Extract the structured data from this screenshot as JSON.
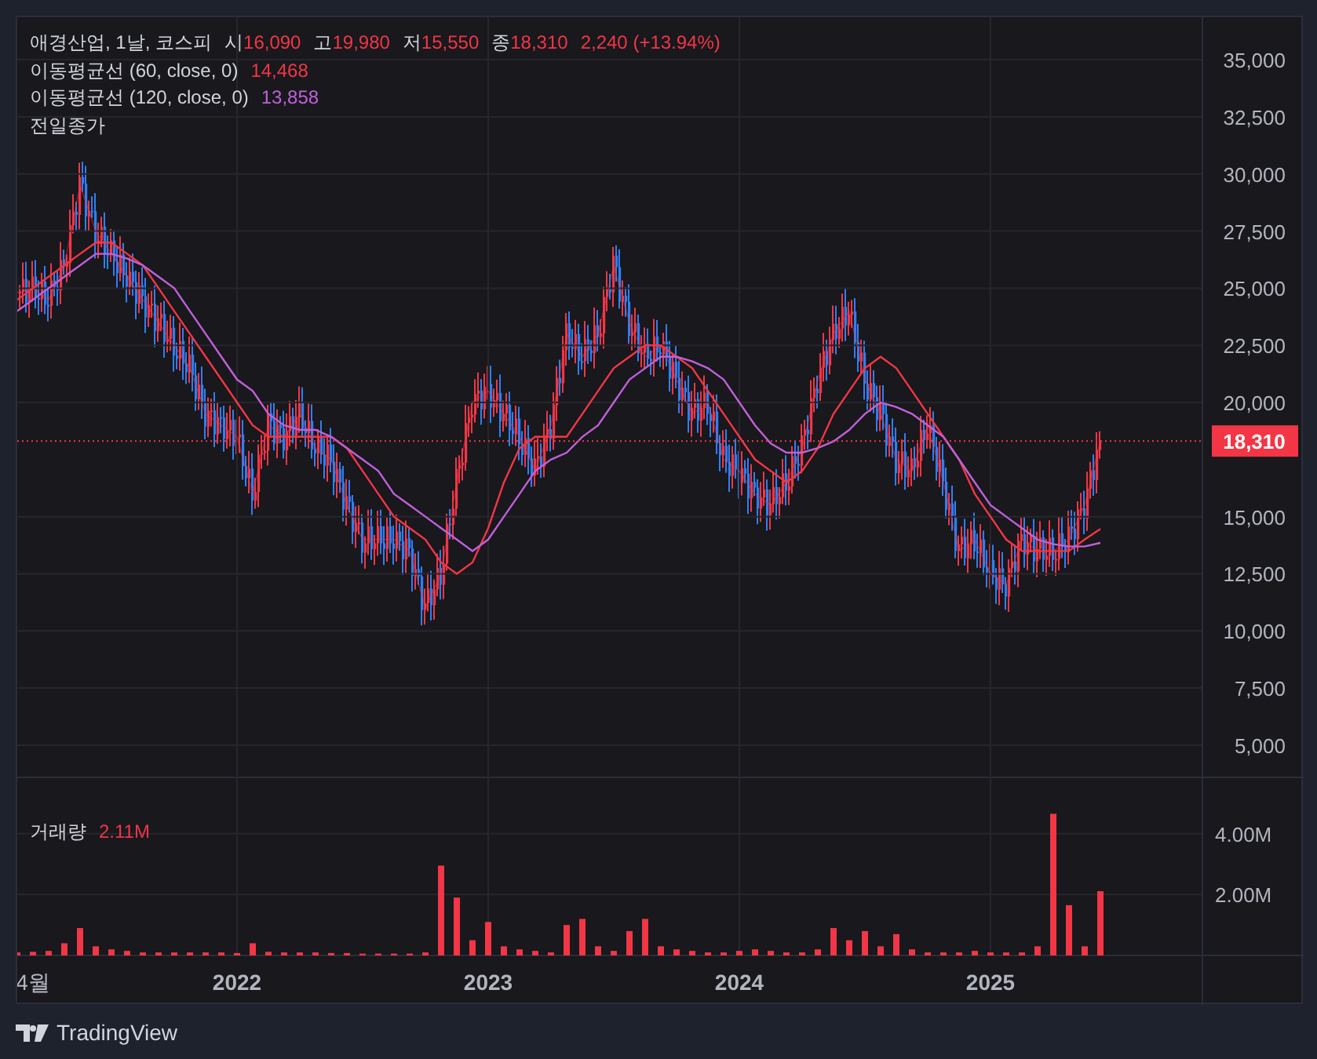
{
  "legend": {
    "title_suffix": ", 1날, 코스피",
    "ohlc": [
      {
        "label": "시",
        "value": "16,090"
      },
      {
        "label": "고",
        "value": "19,980"
      },
      {
        "label": "저",
        "value": "15,550"
      },
      {
        "label": "종",
        "value": "18,310"
      }
    ],
    "change": "2,240 (+13.94%)",
    "indicator_values": [
      "14,468",
      "13,858"
    ],
    "prev_close_label": "전일종가"
  },
  "price_chart": {
    "chart_data": {
      "type": "line",
      "grid": true,
      "ylim": [
        3624,
        36858
      ],
      "ref_lines": [
        {
          "axis": "y",
          "value": 18310,
          "label": "18,310",
          "color": "#f23645"
        }
      ],
      "yticks": [
        {
          "value": 35000,
          "label": "35,000"
        },
        {
          "value": 32500,
          "label": "32,500"
        },
        {
          "value": 30000,
          "label": "30,000"
        },
        {
          "value": 27500,
          "label": "27,500"
        },
        {
          "value": 25000,
          "label": "25,000"
        },
        {
          "value": 22500,
          "label": "22,500"
        },
        {
          "value": 20000,
          "label": "20,000"
        },
        {
          "value": 15000,
          "label": "15,000"
        },
        {
          "value": 12500,
          "label": "12,500"
        },
        {
          "value": 10000,
          "label": "10,000"
        },
        {
          "value": 7500,
          "label": "7,500"
        },
        {
          "value": 5000,
          "label": "5,000"
        }
      ],
      "series": [
        {
          "name": "애경산업",
          "color": "#f23645",
          "values": [
            24800,
            25000,
            24500,
            26000,
            29500,
            27500,
            26500,
            25500,
            24500,
            23500,
            22500,
            21500,
            19500,
            19000,
            18500,
            16000,
            19000,
            18500,
            19500,
            18000,
            17500,
            15500,
            14000,
            14000,
            14000,
            13500,
            11000,
            12500,
            16500,
            20000,
            20500,
            19500,
            18500,
            17000,
            19000,
            23000,
            22000,
            23000,
            26000,
            23500,
            22000,
            22500,
            21000,
            19500,
            20000,
            17500,
            17000,
            16000,
            15500,
            16500,
            18000,
            21000,
            23000,
            24000,
            21000,
            19500,
            17500,
            17000,
            19000,
            16500,
            13500,
            14000,
            12500,
            12000,
            14000,
            13500,
            13500,
            14000,
            15500,
            18310
          ]
        },
        {
          "name": "이동평균선 (60, close, 0)",
          "color": "#f23645",
          "values": [
            24500,
            25000,
            25500,
            26000,
            26500,
            27000,
            27000,
            26500,
            26000,
            25000,
            24000,
            23000,
            22000,
            21000,
            20000,
            19000,
            18500,
            18500,
            18500,
            18500,
            18500,
            18000,
            17000,
            16000,
            15000,
            14500,
            14000,
            13000,
            12500,
            13000,
            14500,
            16500,
            18000,
            18500,
            18500,
            18500,
            19500,
            20500,
            21500,
            22000,
            22500,
            22500,
            22000,
            21500,
            20500,
            19500,
            18500,
            17500,
            17000,
            16500,
            17000,
            18000,
            19500,
            20500,
            21500,
            22000,
            21500,
            20500,
            19500,
            18500,
            17500,
            16000,
            15000,
            14000,
            13500,
            13500,
            13500,
            13500,
            14000,
            14468
          ]
        },
        {
          "name": "이동평균선 (120, close, 0)",
          "color": "#c060d8",
          "values": [
            24000,
            24500,
            25000,
            25500,
            26000,
            26500,
            26500,
            26300,
            26000,
            25500,
            25000,
            24000,
            23000,
            22000,
            21000,
            20500,
            19500,
            19000,
            18800,
            18800,
            18500,
            18000,
            17500,
            17000,
            16000,
            15500,
            15000,
            14500,
            14000,
            13500,
            14000,
            15000,
            16000,
            17000,
            17500,
            17800,
            18500,
            19000,
            20000,
            21000,
            21500,
            22000,
            22000,
            21800,
            21500,
            21000,
            20000,
            19000,
            18200,
            17800,
            17800,
            18000,
            18300,
            18800,
            19500,
            20000,
            19800,
            19500,
            19000,
            18500,
            17500,
            16500,
            15500,
            15000,
            14500,
            14000,
            13800,
            13700,
            13700,
            13858
          ]
        }
      ]
    }
  },
  "volume_chart": {
    "value": "2.11M",
    "chart_data": {
      "type": "bar",
      "grid": true,
      "ylim": [
        0,
        5870000
      ],
      "categories": [
        null,
        "4월",
        null,
        null,
        null,
        null,
        null,
        null,
        null,
        null,
        null,
        null,
        null,
        null,
        "2022",
        null,
        null,
        null,
        null,
        null,
        null,
        null,
        null,
        null,
        null,
        null,
        null,
        null,
        null,
        null,
        "2023",
        null,
        null,
        null,
        null,
        null,
        null,
        null,
        null,
        null,
        null,
        null,
        null,
        null,
        null,
        null,
        "2024",
        null,
        null,
        null,
        null,
        null,
        null,
        null,
        null,
        null,
        null,
        null,
        null,
        null,
        null,
        null,
        "2025",
        null,
        null,
        null,
        null,
        null,
        null,
        null
      ],
      "yticks": [
        {
          "value": 4000000,
          "label": "4.00M"
        },
        {
          "value": 2000000,
          "label": "2.00M"
        }
      ],
      "series": [
        {
          "name": "거래량",
          "color": "#f23645",
          "values": [
            100000,
            120000,
            150000,
            400000,
            900000,
            300000,
            200000,
            150000,
            100000,
            100000,
            100000,
            100000,
            100000,
            100000,
            80000,
            400000,
            120000,
            100000,
            100000,
            100000,
            80000,
            80000,
            60000,
            60000,
            60000,
            60000,
            100000,
            2950000,
            1900000,
            500000,
            1100000,
            300000,
            200000,
            150000,
            100000,
            1000000,
            1200000,
            300000,
            150000,
            800000,
            1200000,
            300000,
            200000,
            150000,
            100000,
            100000,
            150000,
            200000,
            150000,
            100000,
            100000,
            200000,
            900000,
            500000,
            800000,
            300000,
            700000,
            200000,
            100000,
            100000,
            100000,
            150000,
            100000,
            100000,
            100000,
            300000,
            4650000,
            1650000,
            300000,
            2110000
          ]
        }
      ]
    }
  },
  "branding": "TradingView"
}
